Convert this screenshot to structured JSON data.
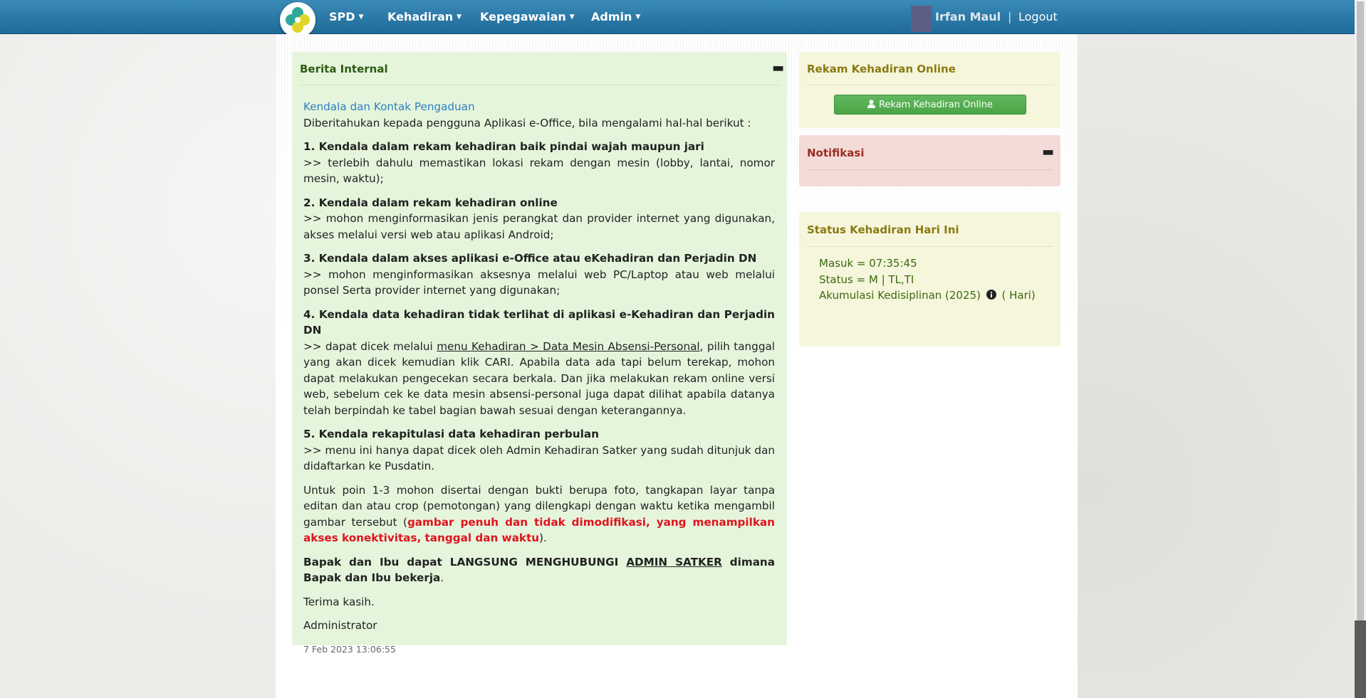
{
  "nav": {
    "items": [
      {
        "label": "SPD"
      },
      {
        "label": "Kehadiran"
      },
      {
        "label": "Kepegawaian"
      },
      {
        "label": "Admin"
      }
    ],
    "user_name": "Irfan Maul",
    "separator": "|",
    "logout": "Logout",
    "logo_icon": "clover-logo-icon",
    "bar_color": "#2a7aac"
  },
  "news": {
    "title": "Berita Internal",
    "collapse": "▬",
    "link": "Kendala dan Kontak Pengaduan",
    "intro": "Diberitahukan kepada pengguna Aplikasi e-Office, bila mengalami hal-hal berikut :",
    "items": [
      {
        "heading": "1. Kendala dalam rekam kehadiran baik pindai wajah maupun jari",
        "text": ">> terlebih dahulu memastikan lokasi rekam dengan mesin (lobby, lantai, nomor mesin, waktu);"
      },
      {
        "heading": "2. Kendala dalam rekam kehadiran online",
        "text": ">> mohon menginformasikan jenis perangkat dan provider internet yang digunakan, akses melalui versi web atau aplikasi Android;"
      },
      {
        "heading": "3. Kendala dalam akses aplikasi e-Office atau eKehadiran dan Perjadin DN",
        "text": ">> mohon menginformasikan aksesnya melalui web PC/Laptop atau web melalui ponsel Serta provider internet yang digunakan;"
      },
      {
        "heading": "4. Kendala data kehadiran tidak terlihat di aplikasi e-Kehadiran dan Perjadin DN",
        "text_a": ">> dapat dicek melalui ",
        "link": "menu Kehadiran > Data Mesin Absensi-Personal",
        "text_b": ", pilih tanggal yang akan dicek kemudian klik CARI. Apabila data ada tapi belum terekap, mohon dapat melakukan pengecekan secara berkala. Dan jika melakukan rekam online versi web, sebelum cek ke data mesin absensi-personal juga dapat dilihat apabila datanya telah berpindah ke tabel bagian bawah sesuai dengan keterangannya."
      },
      {
        "heading": "5. Kendala rekapitulasi data kehadiran perbulan",
        "text": ">> menu ini hanya dapat dicek oleh Admin Kehadiran Satker yang sudah ditunjuk dan didaftarkan ke Pusdatin."
      }
    ],
    "poin_a": "Untuk poin 1-3 mohon disertai dengan bukti berupa foto, tangkapan layar tanpa editan dan atau crop (pemotongan) yang dilengkapi dengan waktu ketika mengambil gambar tersebut (",
    "poin_red": "gambar penuh dan tidak dimodifikasi, yang menampilkan akses konektivitas, tanggal dan waktu",
    "poin_b": ").",
    "contact_a": "Bapak dan Ibu dapat LANGSUNG MENGHUBUNGI ",
    "contact_link": "ADMIN SATKER",
    "contact_b": " dimana Bapak dan Ibu bekerja",
    "contact_end": ".",
    "thanks": "Terima kasih.",
    "signature": "Administrator",
    "date": "7 Feb 2023 13:06:55"
  },
  "rekam": {
    "title": "Rekam Kehadiran Online",
    "button": "Rekam Kehadiran Online",
    "button_icon": "user-icon"
  },
  "notif": {
    "title": "Notifikasi",
    "collapse": "▬"
  },
  "status": {
    "title": "Status Kehadiran Hari Ini",
    "masuk": "Masuk = 07:35:45",
    "status": "Status = M | TL,TI",
    "akumulasi": "Akumulasi Kedisiplinan (2025)",
    "info_icon": "info-icon",
    "hari": "( Hari)"
  }
}
